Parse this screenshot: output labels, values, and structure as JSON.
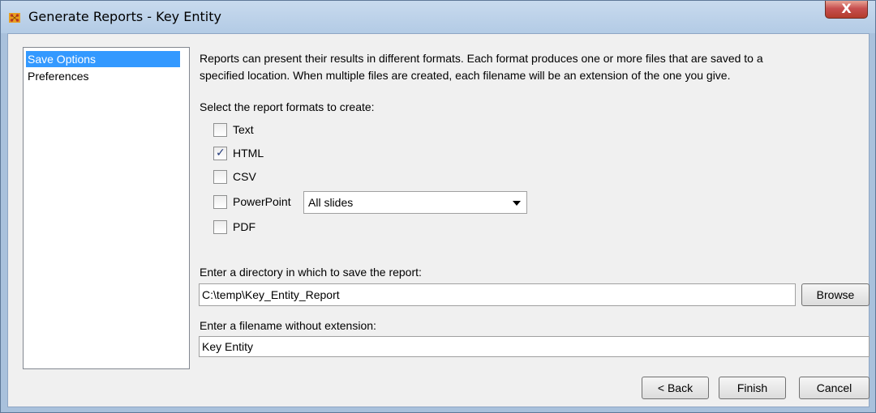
{
  "window": {
    "title": "Generate Reports - Key Entity",
    "close_glyph": "X",
    "app_icon": "network-graph-icon"
  },
  "nav": {
    "items": [
      {
        "label": "Save Options",
        "selected": true
      },
      {
        "label": "Preferences",
        "selected": false
      }
    ]
  },
  "content": {
    "description_line1": "Reports can present their results in different formats. Each format produces one or more files that are saved to a",
    "description_line2": "specified location. When multiple files are created, each filename will be an extension of the one you give.",
    "formats_label": "Select the report formats to create:",
    "formats": [
      {
        "label": "Text",
        "checked": false
      },
      {
        "label": "HTML",
        "checked": true
      },
      {
        "label": "CSV",
        "checked": false
      },
      {
        "label": "PowerPoint",
        "checked": false
      },
      {
        "label": "PDF",
        "checked": false
      }
    ],
    "check_glyph": "✓",
    "powerpoint_option": "All slides",
    "directory_label": "Enter a directory in which to save the report:",
    "directory_value": "C:\\temp\\Key_Entity_Report",
    "browse_label": "Browse",
    "filename_label": "Enter a filename without extension:",
    "filename_value": "Key Entity"
  },
  "footer": {
    "back_label": "< Back",
    "finish_label": "Finish",
    "cancel_label": "Cancel"
  },
  "colors": {
    "selection": "#3399ff",
    "window_frame": "#a9c1dc",
    "close_button": "#c75050"
  }
}
